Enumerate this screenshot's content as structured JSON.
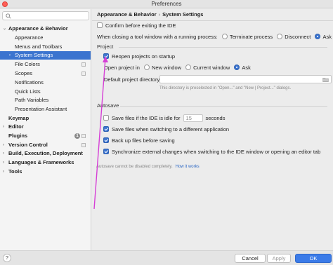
{
  "window": {
    "title": "Preferences"
  },
  "sidebar": {
    "search_placeholder": "",
    "items": [
      {
        "label": "Appearance & Behavior",
        "arrow": "⌄"
      },
      {
        "label": "Appearance"
      },
      {
        "label": "Menus and Toolbars"
      },
      {
        "label": "System Settings",
        "arrow": "›"
      },
      {
        "label": "File Colors"
      },
      {
        "label": "Scopes"
      },
      {
        "label": "Notifications"
      },
      {
        "label": "Quick Lists"
      },
      {
        "label": "Path Variables"
      },
      {
        "label": "Presentation Assistant"
      },
      {
        "label": "Keymap"
      },
      {
        "label": "Editor",
        "arrow": "›"
      },
      {
        "label": "Plugins",
        "badge": "1"
      },
      {
        "label": "Version Control",
        "arrow": "›"
      },
      {
        "label": "Build, Execution, Deployment",
        "arrow": "›"
      },
      {
        "label": "Languages & Frameworks",
        "arrow": "›"
      },
      {
        "label": "Tools",
        "arrow": "›"
      }
    ]
  },
  "breadcrumb": {
    "part1": "Appearance & Behavior",
    "separator": "›",
    "part2": "System Settings"
  },
  "general": {
    "confirm_exit": "Confirm before exiting the IDE",
    "tool_window_label": "When closing a tool window with a running process:",
    "tool_window_options": [
      "Terminate process",
      "Disconnect",
      "Ask"
    ]
  },
  "project": {
    "title": "Project",
    "reopen": "Reopen projects on startup",
    "open_in_label": "Open project in",
    "open_in_options": [
      "New window",
      "Current window",
      "Ask"
    ],
    "default_dir_label": "Default project directory:",
    "default_dir_value": "",
    "hint": "This directory is preselected in \"Open...\" and \"New | Project...\" dialogs."
  },
  "autosave": {
    "title": "Autosave",
    "idle_prefix": "Save files if the IDE is idle for",
    "idle_value": "15",
    "idle_suffix": "seconds",
    "switch_app": "Save files when switching to a different application",
    "backup": "Back up files before saving",
    "sync": "Synchronize external changes when switching to the IDE window or opening an editor tab",
    "note": "Autosave cannot be disabled completely.",
    "note_link": "How it works"
  },
  "footer": {
    "help": "?",
    "cancel": "Cancel",
    "apply": "Apply",
    "ok": "OK"
  },
  "colors": {
    "accent": "#3b74cf",
    "annotation": "#d63fd6",
    "ok_button": "#3b7be8"
  },
  "icons": [
    "close-icon",
    "search-icon",
    "copy-icon",
    "folder-icon",
    "help-icon"
  ]
}
